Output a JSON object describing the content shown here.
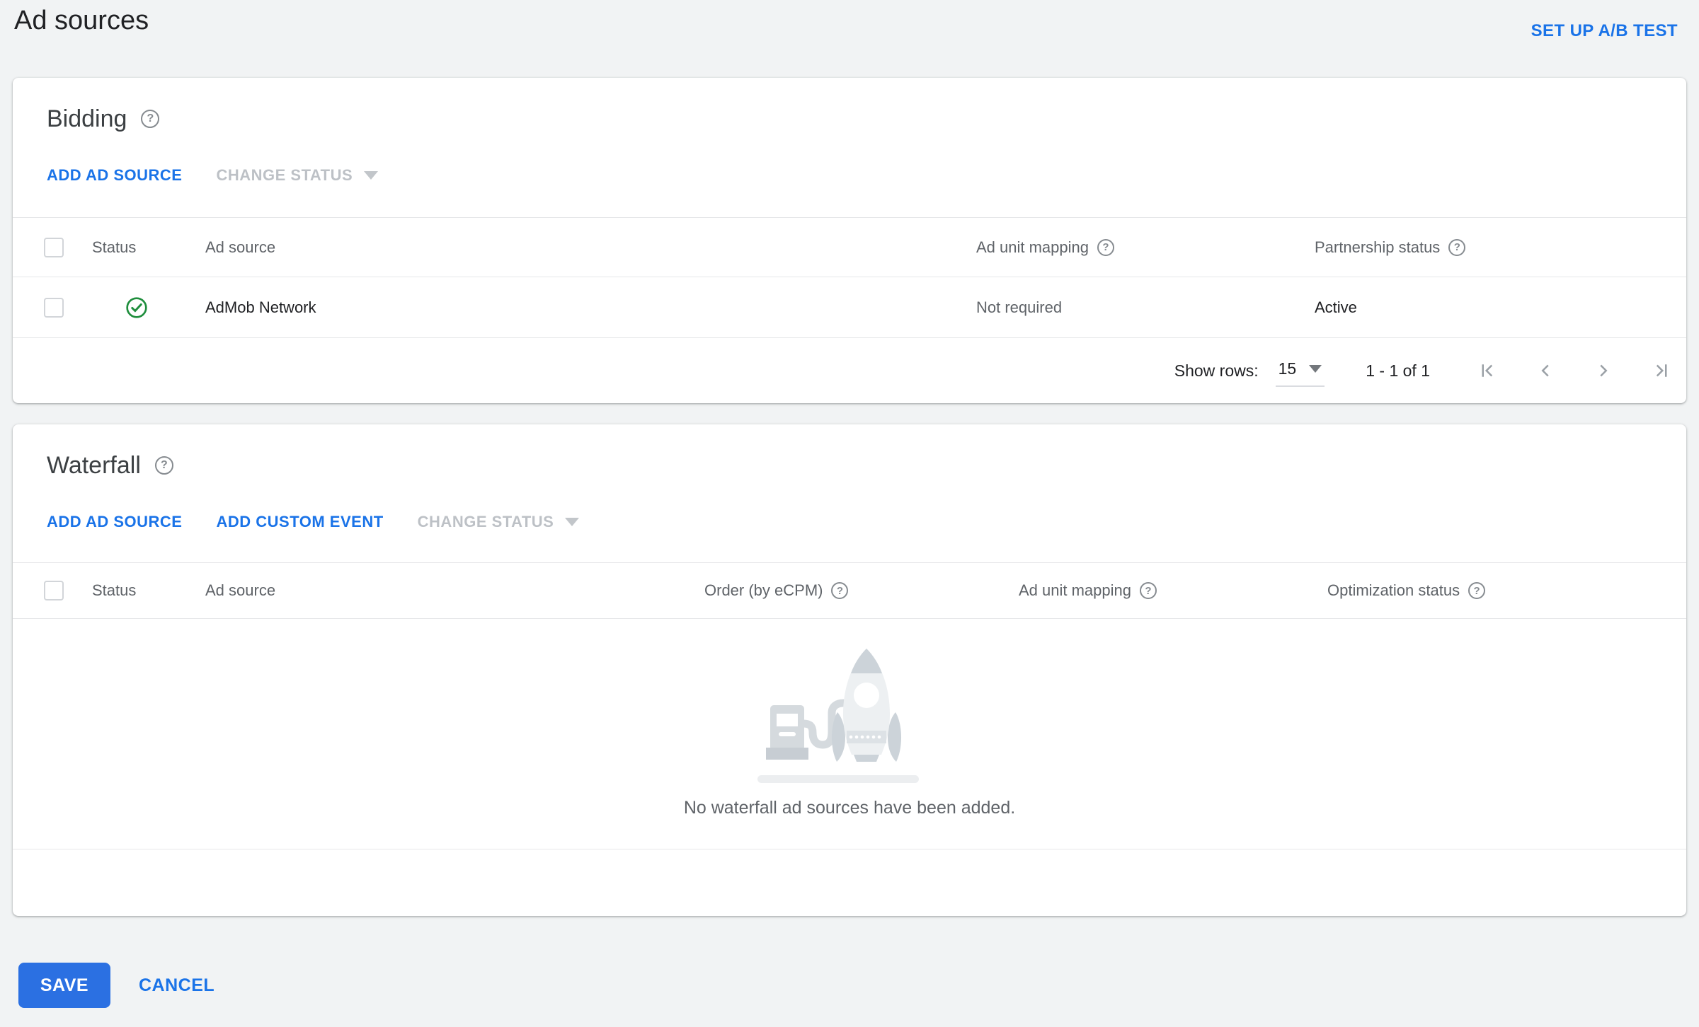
{
  "header": {
    "title": "Ad sources",
    "ab_test_link": "SET UP A/B TEST"
  },
  "icons": {
    "help_glyph": "?"
  },
  "bidding": {
    "title": "Bidding",
    "actions": {
      "add_ad_source": "ADD AD SOURCE",
      "change_status": "CHANGE STATUS"
    },
    "columns": {
      "status": "Status",
      "ad_source": "Ad source",
      "ad_unit_mapping": "Ad unit mapping",
      "partnership_status": "Partnership status"
    },
    "rows": [
      {
        "status_icon": "check-circle-green",
        "ad_source": "AdMob Network",
        "ad_unit_mapping": "Not required",
        "partnership_status": "Active"
      }
    ],
    "pagination": {
      "show_rows_label": "Show rows:",
      "rows_per_page": "15",
      "range_text": "1 - 1 of 1"
    }
  },
  "waterfall": {
    "title": "Waterfall",
    "actions": {
      "add_ad_source": "ADD AD SOURCE",
      "add_custom_event": "ADD CUSTOM EVENT",
      "change_status": "CHANGE STATUS"
    },
    "columns": {
      "status": "Status",
      "ad_source": "Ad source",
      "order": "Order (by eCPM)",
      "ad_unit_mapping": "Ad unit mapping",
      "optimization_status": "Optimization status"
    },
    "empty_message": "No waterfall ad sources have been added."
  },
  "footer": {
    "save": "SAVE",
    "cancel": "CANCEL"
  },
  "colors": {
    "accent_blue": "#1a73e8",
    "save_button_blue": "#2b70e2",
    "success_green": "#1f8e3d",
    "disabled_text": "#bdc1c6",
    "page_background": "#f1f3f4"
  }
}
